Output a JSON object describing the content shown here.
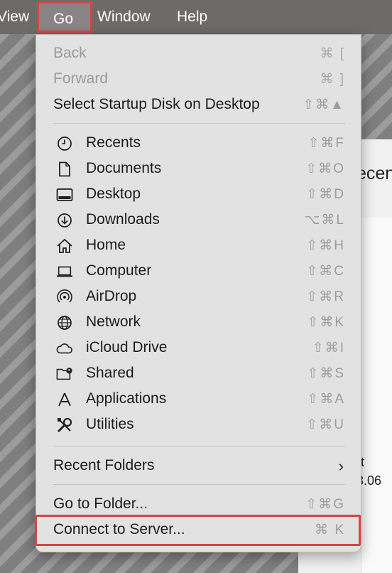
{
  "menubar": {
    "view": "View",
    "go": "Go",
    "window": "Window",
    "help": "Help"
  },
  "background_window": {
    "title_fragment": "ecen",
    "line1": "t",
    "line2": "3.06"
  },
  "menu": {
    "back": {
      "label": "Back",
      "shortcut": "⌘ ["
    },
    "forward": {
      "label": "Forward",
      "shortcut": "⌘ ]"
    },
    "startup_disk": {
      "label": "Select Startup Disk on Desktop",
      "shortcut": "⇧⌘▲"
    },
    "places": [
      {
        "label": "Recents",
        "shortcut": "⇧⌘F",
        "icon": "clock-icon"
      },
      {
        "label": "Documents",
        "shortcut": "⇧⌘O",
        "icon": "document-icon"
      },
      {
        "label": "Desktop",
        "shortcut": "⇧⌘D",
        "icon": "desktop-icon"
      },
      {
        "label": "Downloads",
        "shortcut": "⌥⌘L",
        "icon": "download-icon"
      },
      {
        "label": "Home",
        "shortcut": "⇧⌘H",
        "icon": "home-icon"
      },
      {
        "label": "Computer",
        "shortcut": "⇧⌘C",
        "icon": "laptop-icon"
      },
      {
        "label": "AirDrop",
        "shortcut": "⇧⌘R",
        "icon": "airdrop-icon"
      },
      {
        "label": "Network",
        "shortcut": "⇧⌘K",
        "icon": "globe-icon"
      },
      {
        "label": "iCloud Drive",
        "shortcut": "⇧⌘I",
        "icon": "cloud-icon"
      },
      {
        "label": "Shared",
        "shortcut": "⇧⌘S",
        "icon": "shared-folder-icon"
      },
      {
        "label": "Applications",
        "shortcut": "⇧⌘A",
        "icon": "applications-icon"
      },
      {
        "label": "Utilities",
        "shortcut": "⇧⌘U",
        "icon": "utilities-icon"
      }
    ],
    "recent_folders": {
      "label": "Recent Folders"
    },
    "go_to_folder": {
      "label": "Go to Folder...",
      "shortcut": "⇧⌘G"
    },
    "connect_to_server": {
      "label": "Connect to Server...",
      "shortcut": "⌘ K"
    }
  },
  "colors": {
    "highlight": "#d94444",
    "menu_bg": "#e2e2e2",
    "menubar_bg": "#6e6a6a"
  }
}
